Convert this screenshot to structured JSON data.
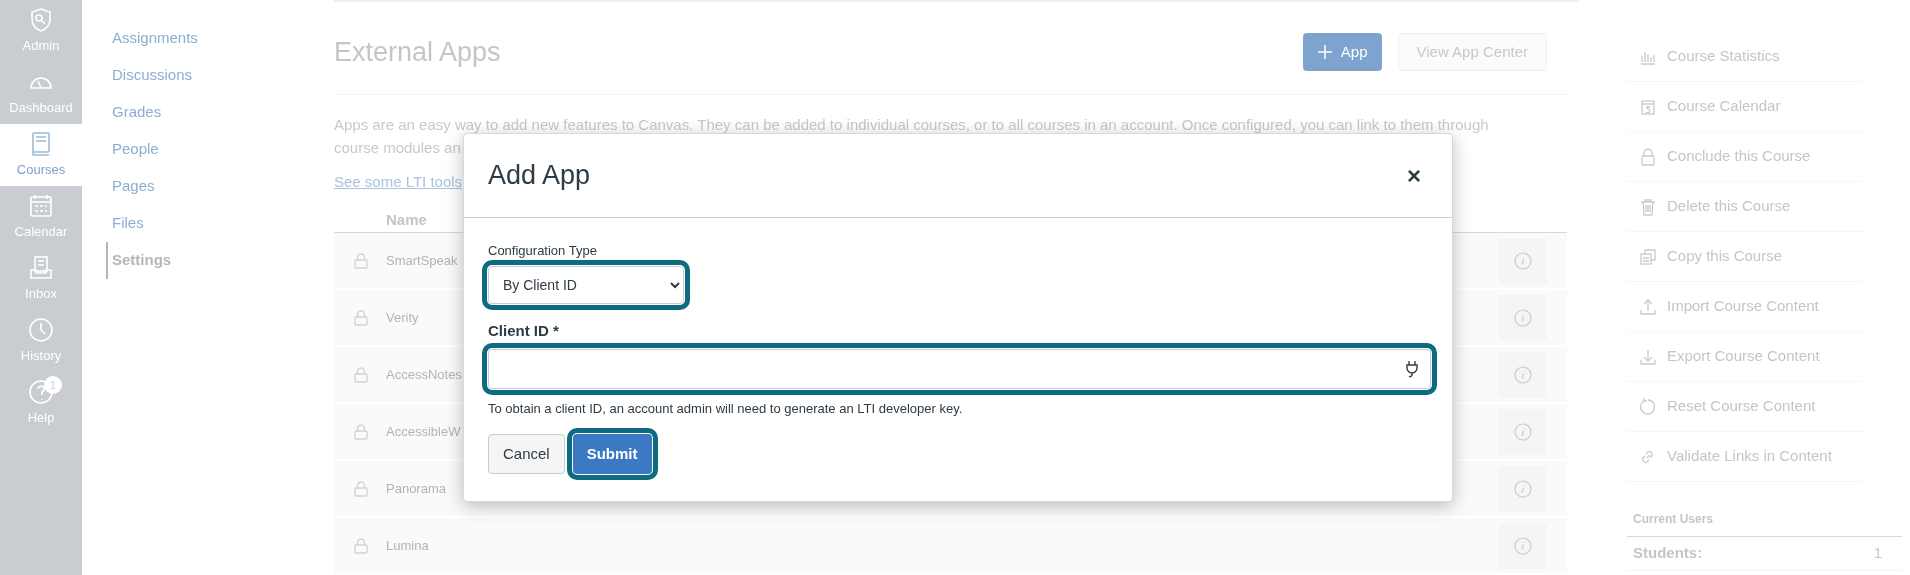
{
  "global_nav": [
    {
      "label": "Admin",
      "selected": false
    },
    {
      "label": "Dashboard",
      "selected": false
    },
    {
      "label": "Courses",
      "selected": true
    },
    {
      "label": "Calendar",
      "selected": false
    },
    {
      "label": "Inbox",
      "selected": false
    },
    {
      "label": "History",
      "selected": false
    },
    {
      "label": "Help",
      "selected": false,
      "badge": "1"
    }
  ],
  "course_nav": [
    {
      "label": "Assignments",
      "selected": false
    },
    {
      "label": "Discussions",
      "selected": false
    },
    {
      "label": "Grades",
      "selected": false
    },
    {
      "label": "People",
      "selected": false
    },
    {
      "label": "Pages",
      "selected": false
    },
    {
      "label": "Files",
      "selected": false
    },
    {
      "label": "Settings",
      "selected": true
    }
  ],
  "page": {
    "title": "External Apps",
    "add_button": "App",
    "app_center_button": "View App Center",
    "description_lines": [
      "Apps are an easy way to add new features to Canvas. They can be added to individual courses, or to all courses in an account. Once configured, you can link to them through",
      "course modules an"
    ],
    "link": "See some LTI tools"
  },
  "table": {
    "columns": [
      "Name"
    ],
    "rows": [
      {
        "name": "SmartSpeak"
      },
      {
        "name": "Verity"
      },
      {
        "name": "AccessNotes"
      },
      {
        "name": "AccessibleW"
      },
      {
        "name": "Panorama"
      },
      {
        "name": "Lumina"
      }
    ]
  },
  "sidebar": {
    "items": [
      {
        "label": "Course Statistics"
      },
      {
        "label": "Course Calendar"
      },
      {
        "label": "Conclude this Course"
      },
      {
        "label": "Delete this Course"
      },
      {
        "label": "Copy this Course"
      },
      {
        "label": "Import Course Content"
      },
      {
        "label": "Export Course Content"
      },
      {
        "label": "Reset Course Content"
      },
      {
        "label": "Validate Links in Content"
      }
    ],
    "users_heading": "Current Users",
    "users": [
      {
        "label": "Students:",
        "count": "1"
      }
    ]
  },
  "dialog": {
    "title": "Add App",
    "close": "×",
    "config_label": "Configuration Type",
    "config_value": "By Client ID",
    "client_label": "Client ID *",
    "help": "To obtain a client ID, an account admin will need to generate an LTI developer key.",
    "cancel": "Cancel",
    "submit": "Submit"
  }
}
